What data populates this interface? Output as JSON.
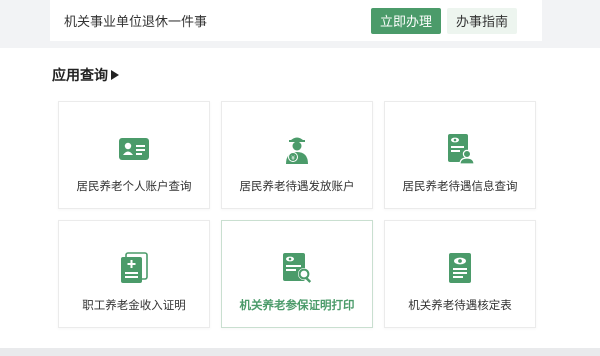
{
  "service": {
    "title": "机关事业单位退休一件事",
    "apply_label": "立即办理",
    "guide_label": "办事指南"
  },
  "section": {
    "title": "应用查询"
  },
  "tiles": [
    {
      "label": "居民养老个人账户查询",
      "icon": "id-card-icon"
    },
    {
      "label": "居民养老待遇发放账户",
      "icon": "worker-payment-icon"
    },
    {
      "label": "居民养老待遇信息查询",
      "icon": "document-user-icon"
    },
    {
      "label": "职工养老金收入证明",
      "icon": "certificate-add-icon"
    },
    {
      "label": "机关养老参保证明打印",
      "icon": "document-search-icon"
    },
    {
      "label": "机关养老待遇核定表",
      "icon": "document-eye-icon"
    }
  ],
  "colors": {
    "accent": "#4b9b6a",
    "accent_light": "#edf5ef"
  }
}
